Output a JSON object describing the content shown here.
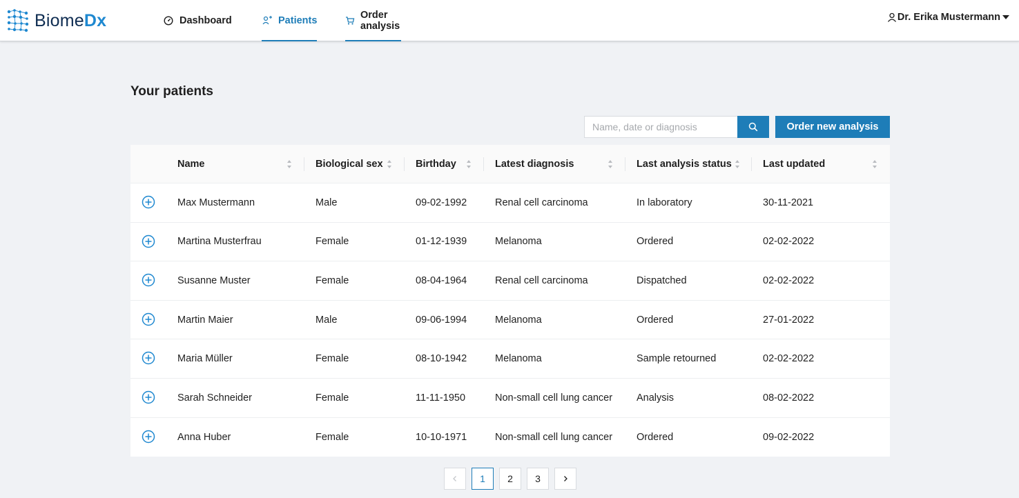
{
  "brand": {
    "name_part1": "Biome",
    "name_part2": "Dx",
    "accent": "#1e7db8"
  },
  "nav": {
    "items": [
      {
        "label": "Dashboard",
        "icon": "dashboard-gauge-icon"
      },
      {
        "label": "Patients",
        "icon": "patients-icon",
        "active": true
      },
      {
        "label": "Order analysis",
        "icon": "cart-icon"
      }
    ]
  },
  "user": {
    "name": "Dr. Erika Mustermann"
  },
  "page": {
    "title": "Your patients"
  },
  "search": {
    "placeholder": "Name, date or diagnosis"
  },
  "actions": {
    "order_new": "Order new analysis"
  },
  "table": {
    "columns": [
      "Name",
      "Biological sex",
      "Birthday",
      "Latest diagnosis",
      "Last analysis status",
      "Last updated"
    ],
    "rows": [
      [
        "Max Mustermann",
        "Male",
        "09-02-1992",
        "Renal cell carcinoma",
        "In laboratory",
        "30-11-2021"
      ],
      [
        "Martina Musterfrau",
        "Female",
        "01-12-1939",
        "Melanoma",
        "Ordered",
        "02-02-2022"
      ],
      [
        "Susanne Muster",
        "Female",
        "08-04-1964",
        "Renal cell carcinoma",
        "Dispatched",
        "02-02-2022"
      ],
      [
        "Martin Maier",
        "Male",
        "09-06-1994",
        "Melanoma",
        "Ordered",
        "27-01-2022"
      ],
      [
        "Maria Müller",
        "Female",
        "08-10-1942",
        "Melanoma",
        "Sample retourned",
        "02-02-2022"
      ],
      [
        "Sarah Schneider",
        "Female",
        "11-11-1950",
        "Non-small cell lung cancer",
        "Analysis",
        "08-02-2022"
      ],
      [
        "Anna Huber",
        "Female",
        "10-10-1971",
        "Non-small cell lung cancer",
        "Ordered",
        "09-02-2022"
      ]
    ]
  },
  "pagination": {
    "pages": [
      "1",
      "2",
      "3"
    ],
    "current": "1",
    "prev_icon": "chevron-left-icon",
    "next_icon": "chevron-right-icon"
  }
}
